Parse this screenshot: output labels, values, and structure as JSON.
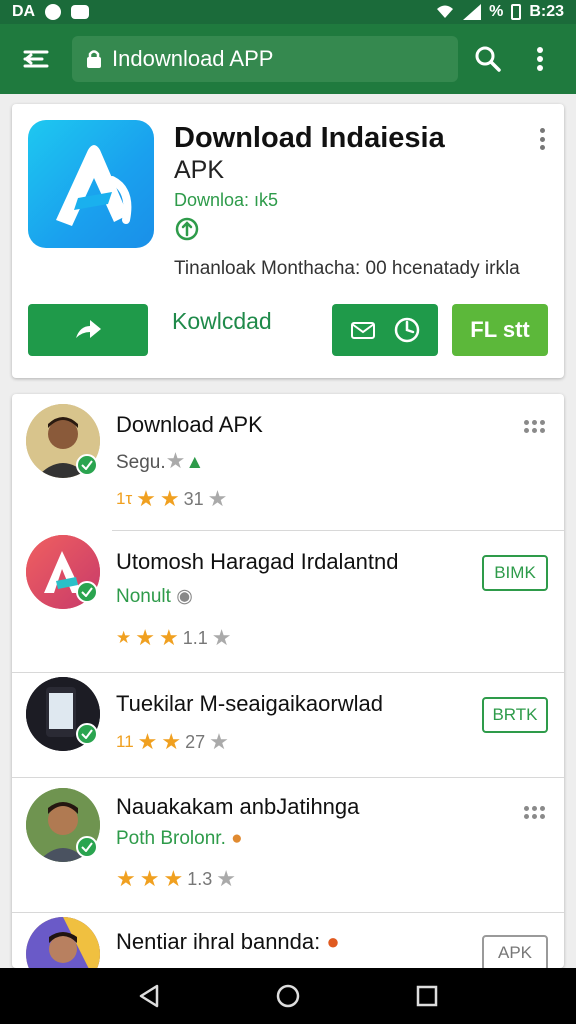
{
  "status_bar": {
    "left_text": "DA",
    "right_text": "B:23",
    "percent": "%"
  },
  "app_bar": {
    "url_text": "Indownload APP"
  },
  "hero": {
    "title": "Download Indaiesia",
    "subtitle": "APK",
    "downloads": "Downloa: ık5",
    "description": "Tinanloak Monthacha: 00 hcenatady irkla",
    "download_link": "Kowlcdad",
    "fl_button": "FL stt"
  },
  "list": [
    {
      "title": "Download APK",
      "subtitle": "Segu.",
      "subtitle_color": "#555555",
      "rating_lead": "1τ",
      "rating_value": "31"
    },
    {
      "title": "Utomosh Haragad Irdalantnd",
      "subtitle": "Nonult",
      "subtitle_color": "#2e9b4a",
      "rating_lead": "★",
      "rating_value": "1.1",
      "action_label": "BIMK"
    },
    {
      "title": "Tuekilar M-seaigaikaorwlad",
      "subtitle": "",
      "rating_lead": "11",
      "rating_value": "27",
      "action_label": "BRTK"
    },
    {
      "title": "Nauakakam anbJatihnga",
      "subtitle": "Poth Brolonr.",
      "subtitle_color": "#2e9b4a",
      "rating_lead": "",
      "rating_value": "1.3"
    },
    {
      "title": "Nentiar ihral bannda:",
      "action_label": "APK"
    }
  ],
  "colors": {
    "primary": "#1f7a3e",
    "accent": "#2e9b4a",
    "star": "#f0a020"
  }
}
